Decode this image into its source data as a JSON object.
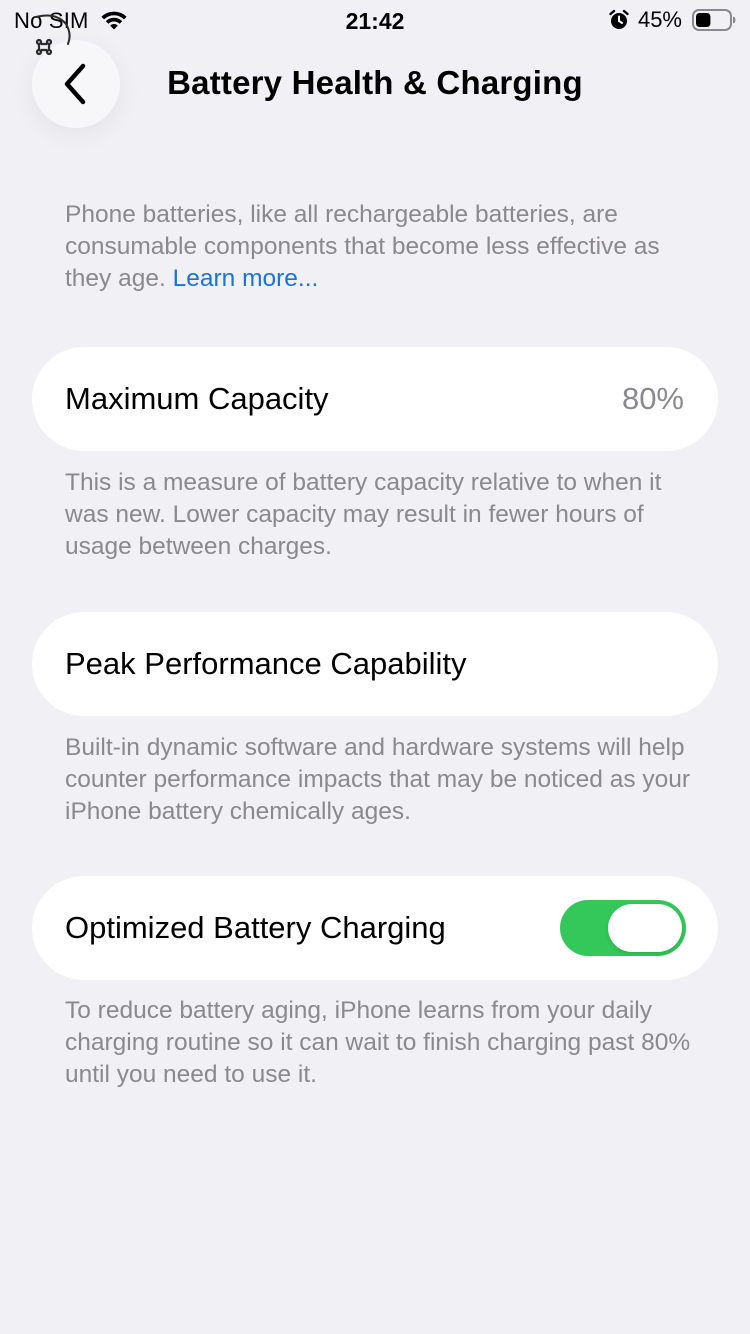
{
  "status_bar": {
    "carrier": "No SIM",
    "time": "21:42",
    "battery_percent": "45%",
    "battery_level": 0.45,
    "icons": [
      "wifi-icon",
      "alarm-icon",
      "battery-icon"
    ]
  },
  "nav": {
    "title": "Battery Health & Charging",
    "back_icon": "chevron-left-icon",
    "assistive_icon": "command-icon"
  },
  "intro": {
    "text": "Phone batteries, like all rechargeable batteries, are consumable components that become less effective as they age. ",
    "link": "Learn more..."
  },
  "maximum_capacity": {
    "label": "Maximum Capacity",
    "value": "80%",
    "description": "This is a measure of battery capacity relative to when it was new. Lower capacity may result in fewer hours of usage between charges."
  },
  "peak_performance": {
    "label": "Peak Performance Capability",
    "description": "Built-in dynamic software and hardware systems will help counter performance impacts that may be noticed as your iPhone battery chemically ages."
  },
  "optimized_charging": {
    "label": "Optimized Battery Charging",
    "enabled": true,
    "toggle_color": "#34c759",
    "description": "To reduce battery aging, iPhone learns from your daily charging routine so it can wait to finish charging past 80% until you need to use it."
  },
  "colors": {
    "background": "#f1f0f5",
    "secondary_text": "#8a898e",
    "link": "#1a73d9"
  }
}
